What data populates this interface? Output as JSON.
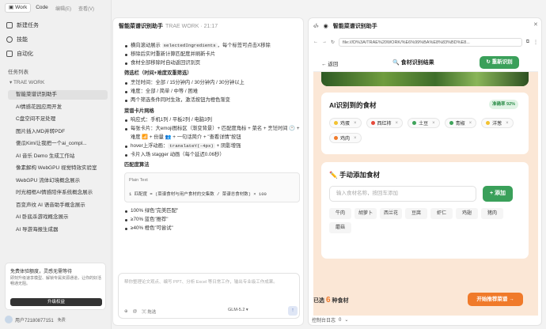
{
  "sidebar": {
    "tabs": {
      "work": "Work",
      "code": "Code"
    },
    "menus": {
      "edit": "编辑(E)",
      "view": "查看(V)"
    },
    "new_task": "新建任务",
    "skills": "技能",
    "automation": "自动化",
    "task_list_title": "任务列表",
    "group": "TRAE WORK",
    "tasks": [
      "智能菜谱识别助手",
      "AI情感花园应用开发",
      "C盘空间不足处理",
      "图片插入MD并转PDF",
      "傻瓜Kimi让我把一个ai_compl...",
      "AI 音乐 Demo 生成工作站",
      "像素解构 WebGPU 视觉特效实验室",
      "WebGPU 流体幻境概念展示",
      "时光相框AI情感陪伴系统概念展示",
      "百变声纹 AI 语音助手概念展示",
      "AI 卧底杀游戏概念展示",
      "AI 导游海报生成器"
    ],
    "promo": {
      "title": "免费体验额度，灵感无需等待",
      "desc": "即刻升级速享模型、解锁专属资源通道，让你的好活畅通无阻。",
      "button": "升级权益"
    },
    "user": {
      "name": "用户72180877151",
      "tag": "免费"
    }
  },
  "chat": {
    "title": "智能菜谱识别助手",
    "meta": "TRAE WORK · 21:17",
    "lines_a": [
      "横向滚动展示",
      "，每个标签可点击X移除"
    ],
    "code_a": "selectedIngredients",
    "lines_b": [
      "移除后实时重新计算匹配度并刷新卡片",
      "食材全部移除时自动返回识别页"
    ],
    "h1": "筛选栏（时间+难度双重筛选）",
    "filters": [
      "烹饪时间：全部 / 15分钟内 / 30分钟内 / 30分钟以上",
      "难度：全部 / 简单 / 中等 / 困难",
      "两个筛选条件同时生效，激活按钮为橙色渐变"
    ],
    "h2": "菜谱卡片网格",
    "cards": [
      "响应式：手机1列 / 平板2列 / 电脑3列",
      "每张卡片：大emoji图标区（渐变背景）+ 匹配度角标 + 菜名 + 烹饪时间 🕐 + 难度 📶 + 份量 👥 + 一句话简介 + \"查看详情\"按钮"
    ],
    "hover_a": "hover上浮动画：",
    "hover_code": "translateY(-4px)",
    "hover_b": " + 阴影增强",
    "stagger": "卡片入场 stagger 动画（每个延迟0.06秒）",
    "h3": "匹配度算法",
    "codebox": {
      "lang": "Plain Text",
      "line": "1  匹配度 = (菜谱食材与用户食材的交集数 / 菜谱总食材数) × 100"
    },
    "scores": [
      "100% 绿色\"完美匹配\"",
      "≥70% 蓝色\"推荐\"",
      "≥40% 橙色\"可尝试\""
    ],
    "input_placeholder": "帮你整理论文观点、编写 PPT、分析 Excel 等日常工作，输出专业级工作成果。",
    "tool": "拖选",
    "model": "GLM-5.2"
  },
  "preview": {
    "title": "智能菜谱识别助手",
    "url": "file:///D%3A/TRAE%20WORK/%E6%99%BA%E8%83%BD%E8...",
    "app": {
      "back": "返回",
      "title": "🔍 食材识别结果",
      "reid": "↻ 重新识别",
      "found_title": "AI识别到的食材",
      "accuracy": "准确率 92%",
      "ingredients": [
        {
          "name": "鸡蛋",
          "color": "#f2c230"
        },
        {
          "name": "西红柿",
          "color": "#e5493a"
        },
        {
          "name": "土豆",
          "color": "#3ea35a"
        },
        {
          "name": "青椒",
          "color": "#3ea35a"
        },
        {
          "name": "洋葱",
          "color": "#f2c230"
        },
        {
          "name": "鸡肉",
          "color": "#f07a2a"
        }
      ],
      "manual_title": "✏️ 手动添加食材",
      "input_placeholder": "输入食材名称，按回车添加",
      "add": "+ 添加",
      "suggestions": [
        "牛肉",
        "胡萝卜",
        "西兰花",
        "豆腐",
        "虾仁",
        "鸡翅",
        "猪肉",
        "蘑菇"
      ],
      "selected_pre": "已选",
      "selected_count": "6",
      "selected_post": "种食材",
      "go": "开始推荐菜谱 →"
    },
    "console": "控制台日志",
    "console_count": "0"
  },
  "colors": {
    "green": "#3aa05a",
    "orange": "#f07a2a",
    "peach": "#fbe7d6"
  }
}
